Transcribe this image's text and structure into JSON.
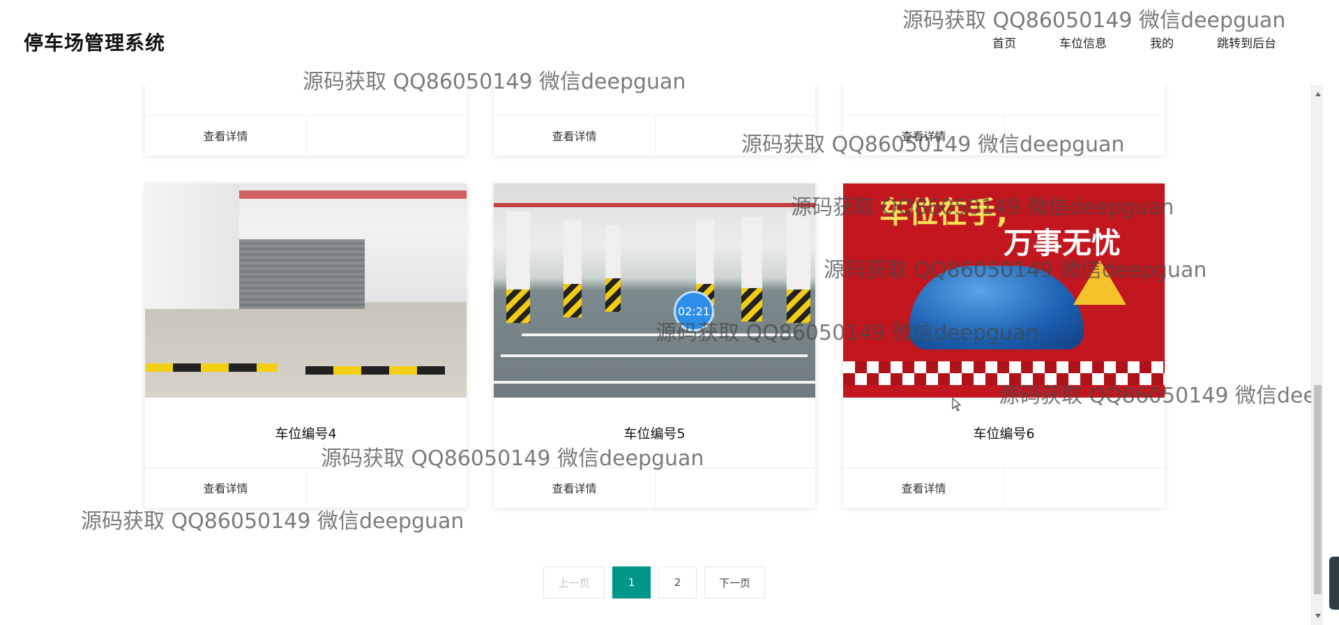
{
  "header": {
    "title": "停车场管理系统",
    "nav": [
      "首页",
      "车位信息",
      "我的",
      "跳转到后台"
    ]
  },
  "top_cards": [
    {
      "detail_label": "查看详情"
    },
    {
      "detail_label": "查看详情"
    },
    {
      "detail_label": "查看详情"
    }
  ],
  "cards": [
    {
      "name": "车位编号4",
      "detail_label": "查看详情"
    },
    {
      "name": "车位编号5",
      "detail_label": "查看详情",
      "timer_badge": "02:21"
    },
    {
      "name": "车位编号6",
      "detail_label": "查看详情",
      "poster_line1": "车位在手,",
      "poster_line2": "万事无忧"
    }
  ],
  "pagination": {
    "prev": "上一页",
    "pages": [
      "1",
      "2"
    ],
    "current": "1",
    "next": "下一页",
    "accent_color": "#009688"
  },
  "watermark": "源码获取 QQ86050149 微信deepguan"
}
